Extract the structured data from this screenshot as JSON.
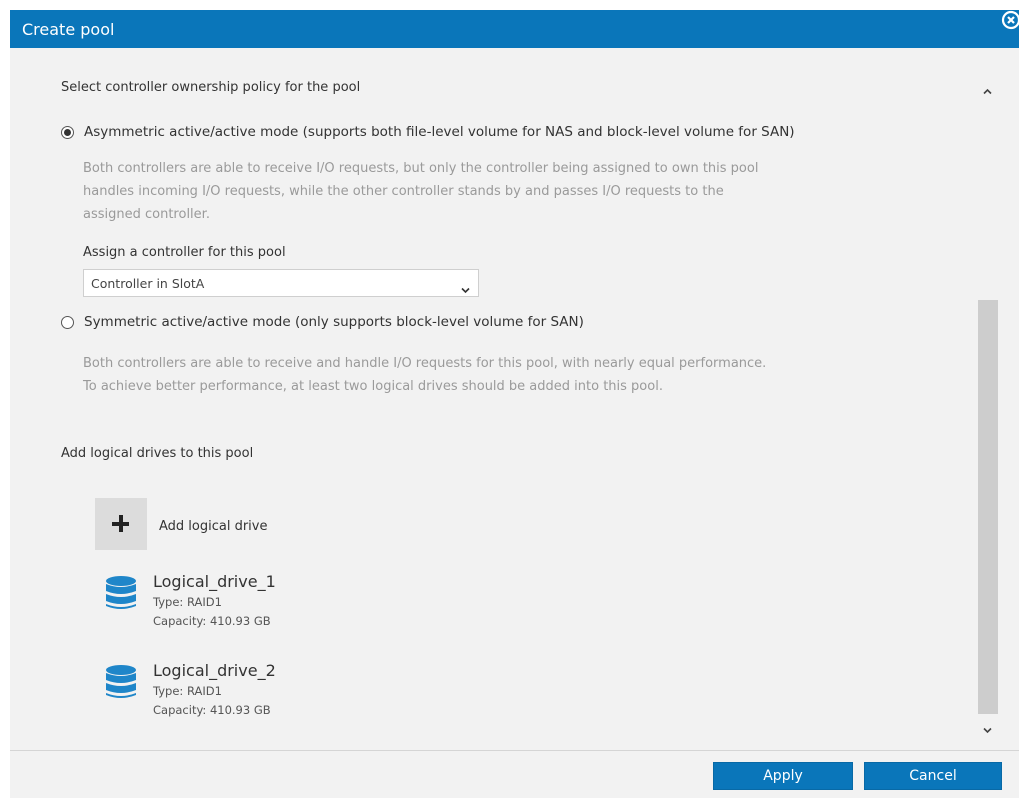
{
  "dialog": {
    "title": "Create pool",
    "close_icon": "close-circle-icon"
  },
  "ownership": {
    "heading": "Select controller ownership policy for the pool",
    "asymmetric": {
      "label": "Asymmetric active/active mode (supports both file-level volume for NAS and block-level volume for SAN)",
      "selected": true,
      "description": [
        "Both controllers are able to receive I/O requests, but only the controller being assigned to own this pool",
        "handles incoming I/O requests, while the other controller stands by and passes I/O requests to the",
        "assigned controller."
      ],
      "assign_label": "Assign a controller for this pool",
      "controller_selected": "Controller in SlotA"
    },
    "symmetric": {
      "label": "Symmetric active/active mode (only supports block-level volume for SAN)",
      "selected": false,
      "description": [
        "Both controllers are able to receive and handle I/O requests for this pool, with nearly equal performance.",
        "To achieve better performance, at least two logical drives should be added into this pool."
      ]
    }
  },
  "drives": {
    "heading": "Add logical drives to this pool",
    "add_label": "Add logical drive",
    "add_icon": "plus-icon",
    "drive_icon": "database-icon",
    "items": [
      {
        "name": "Logical_drive_1",
        "type": "Type: RAID1",
        "capacity": "Capacity: 410.93 GB"
      },
      {
        "name": "Logical_drive_2",
        "type": "Type: RAID1",
        "capacity": "Capacity: 410.93 GB"
      }
    ]
  },
  "footer": {
    "apply_label": "Apply",
    "cancel_label": "Cancel"
  },
  "colors": {
    "accent": "#0a76ba",
    "background": "#f2f2f2",
    "drive_icon": "#1f86c9"
  }
}
